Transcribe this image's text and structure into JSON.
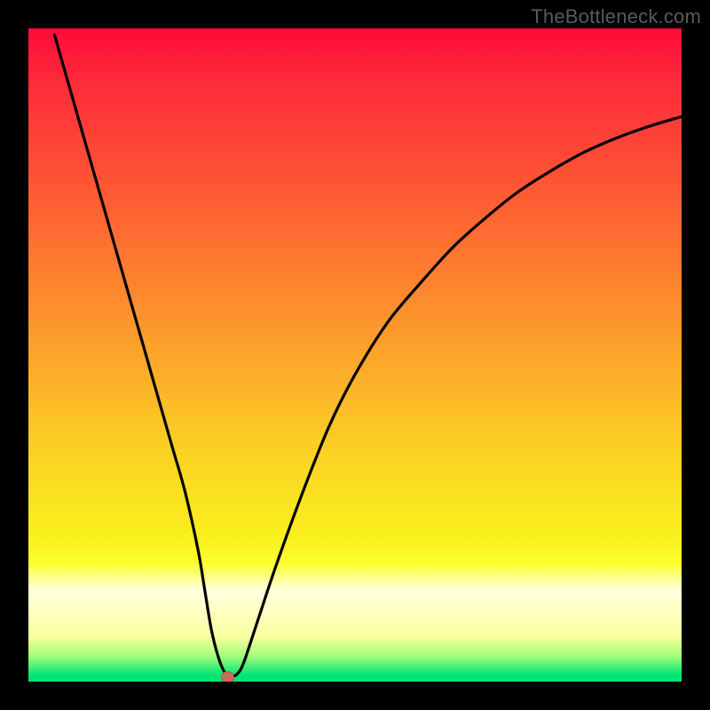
{
  "watermark": "TheBottleneck.com",
  "colors": {
    "page_bg": "#000000",
    "gradient_top": "#ff0a3a",
    "gradient_mid": "#fcd024",
    "gradient_bottom": "#00e676",
    "curve_stroke": "#000000",
    "marker_fill": "#cc6b5a"
  },
  "chart_data": {
    "type": "line",
    "title": "",
    "xlabel": "",
    "ylabel": "",
    "xlim": [
      0,
      100
    ],
    "ylim": [
      0,
      100
    ],
    "x": [
      4,
      6,
      8,
      10,
      12,
      14,
      16,
      18,
      20,
      22,
      24,
      26,
      27,
      28,
      29,
      30,
      31,
      32,
      33,
      35,
      38,
      42,
      46,
      50,
      55,
      60,
      65,
      70,
      75,
      80,
      85,
      90,
      95,
      100
    ],
    "values": [
      99,
      92,
      85,
      78,
      71,
      64,
      57,
      50,
      43,
      36,
      29,
      20,
      14,
      8,
      4,
      1.5,
      0.8,
      1.2,
      3,
      9,
      18,
      29,
      39,
      47,
      55,
      61,
      66.5,
      71,
      75,
      78.2,
      81,
      83.2,
      85,
      86.5
    ],
    "marker": {
      "x": 30.5,
      "y": 0.6
    }
  }
}
